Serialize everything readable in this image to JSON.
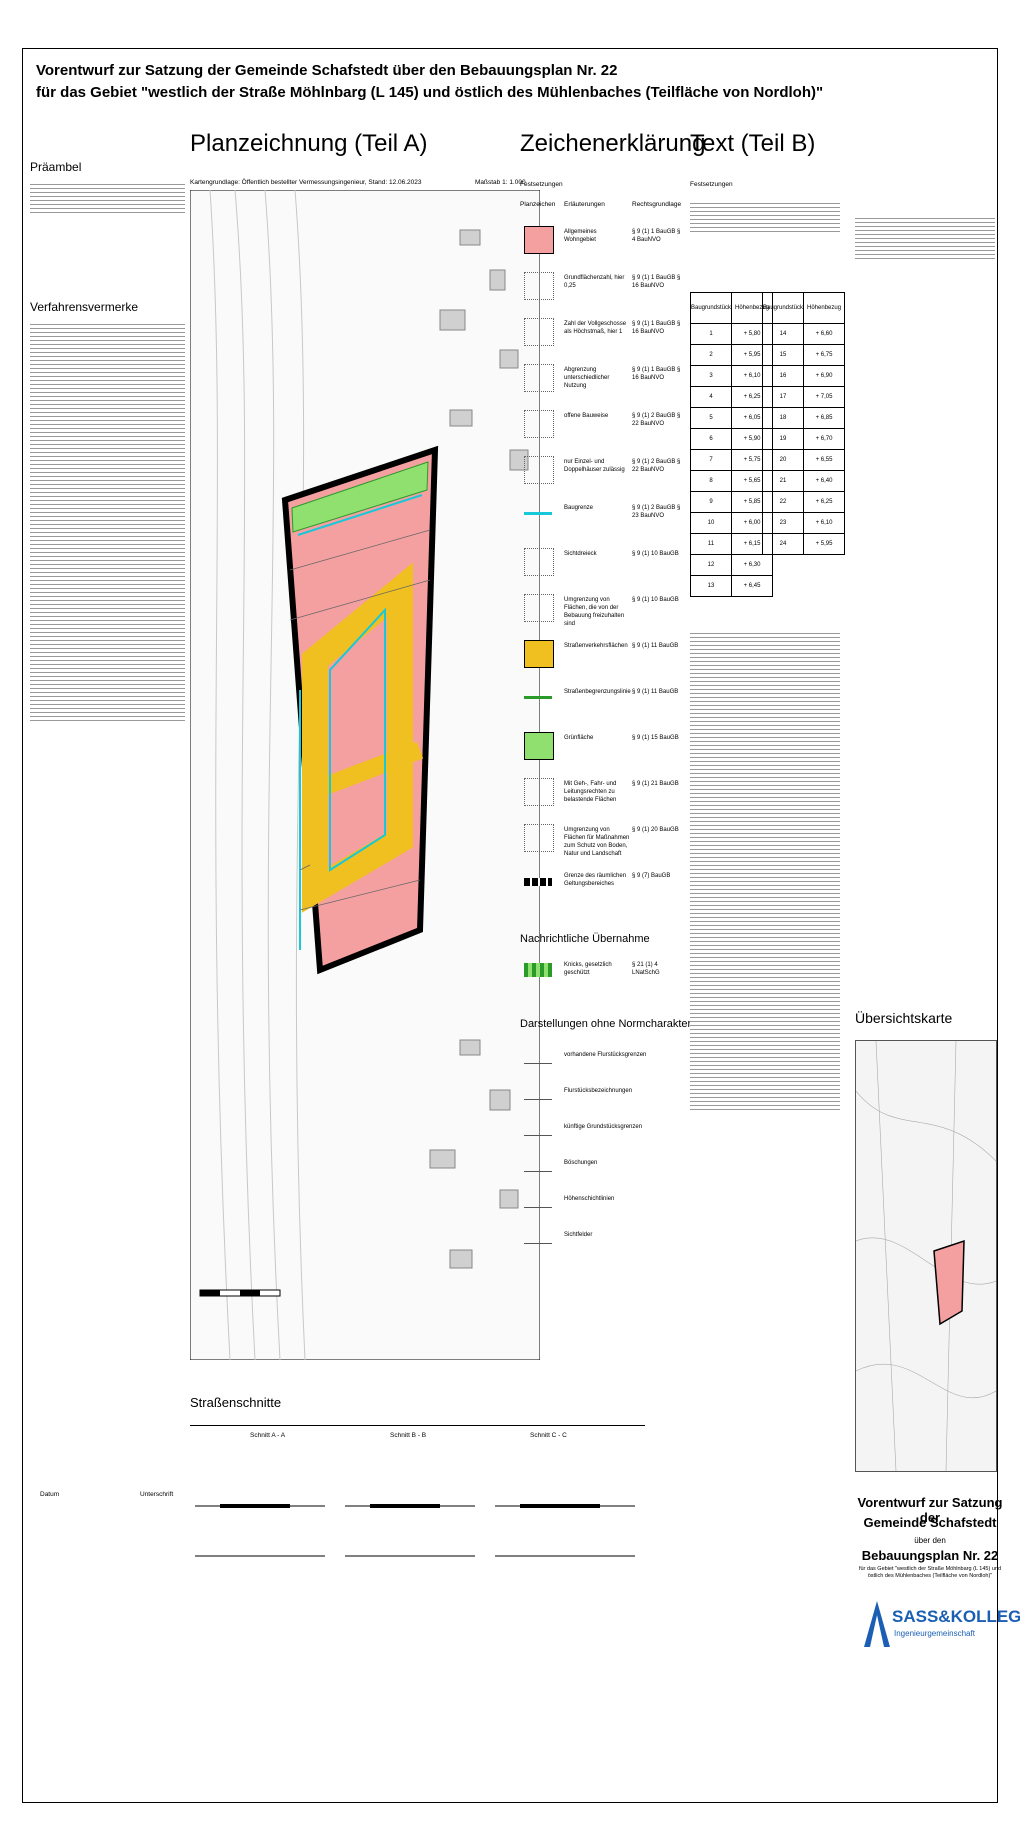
{
  "titles": {
    "line1": "Vorentwurf zur Satzung der Gemeinde Schafstedt über den Bebauungsplan Nr. 22",
    "line2": "für das Gebiet \"westlich der Straße Möhlnbarg (L 145) und östlich des Mühlenbaches (Teilfläche von Nordloh)\""
  },
  "sections": {
    "planzeichnung": "Planzeichnung (Teil A)",
    "zeichenerklaerung": "Zeichenerklärung",
    "text": "Text (Teil B)",
    "praeambel": "Präambel",
    "verfahrensvermerke": "Verfahrensvermerke",
    "festsetzungen": "Festsetzungen",
    "nachrichtliche": "Nachrichtliche Übernahme",
    "darstellungen": "Darstellungen ohne Normcharakter",
    "strassenschnitte": "Straßenschnitte",
    "uebersichtskarte": "Übersichtskarte"
  },
  "legend_header": {
    "c1": "Planzeichen",
    "c2": "Erläuterungen",
    "c3": "Rechtsgrundlage"
  },
  "legend_items": [
    {
      "label": "Allgemeines Wohngebiet",
      "law": "§ 9 (1) 1 BauGB § 4 BauNVO",
      "color": "#f4a0a0"
    },
    {
      "label": "Grundflächenzahl, hier 0,25",
      "law": "§ 9 (1) 1 BauGB § 16 BauNVO",
      "color": ""
    },
    {
      "label": "Zahl der Vollgeschosse als Höchstmaß, hier 1",
      "law": "§ 9 (1) 1 BauGB § 16 BauNVO",
      "color": ""
    },
    {
      "label": "Abgrenzung unterschiedlicher Nutzung",
      "law": "§ 9 (1) 1 BauGB § 16 BauNVO",
      "color": ""
    },
    {
      "label": "offene Bauweise",
      "law": "§ 9 (1) 2 BauGB § 22 BauNVO",
      "color": ""
    },
    {
      "label": "nur Einzel- und Doppelhäuser zulässig",
      "law": "§ 9 (1) 2 BauGB § 22 BauNVO",
      "color": ""
    },
    {
      "label": "Baugrenze",
      "law": "§ 9 (1) 2 BauGB § 23 BauNVO",
      "color": "#18c8d8"
    },
    {
      "label": "Sichtdreieck",
      "law": "§ 9 (1) 10 BauGB",
      "color": ""
    },
    {
      "label": "Umgrenzung von Flächen, die von der Bebauung freizuhalten sind",
      "law": "§ 9 (1) 10 BauGB",
      "color": ""
    },
    {
      "label": "Straßenverkehrsflächen",
      "law": "§ 9 (1) 11 BauGB",
      "color": "#f0c020"
    },
    {
      "label": "Straßenbegrenzungslinie",
      "law": "§ 9 (1) 11 BauGB",
      "color": "#2a9a2a"
    },
    {
      "label": "Grünfläche",
      "law": "§ 9 (1) 15 BauGB",
      "color": "#90e070"
    },
    {
      "label": "Mit Geh-, Fahr- und Leitungsrechten zu belastende Flächen",
      "law": "§ 9 (1) 21 BauGB",
      "color": ""
    },
    {
      "label": "Umgrenzung von Flächen für Maßnahmen zum Schutz von Boden, Natur und Landschaft",
      "law": "§ 9 (1) 20 BauGB",
      "color": ""
    },
    {
      "label": "Grenze des räumlichen Geltungsbereiches",
      "law": "§ 9 (7) BauGB",
      "color": "#000000"
    }
  ],
  "nachrichtliche_items": [
    {
      "label": "Knicks, gesetzlich geschützt",
      "law": "§ 21 (1) 4 LNatSchG"
    }
  ],
  "darstellungen_items": [
    "vorhandene Flurstücksgrenzen",
    "Flurstücksbezeichnungen",
    "künftige Grundstücksgrenzen",
    "Böschungen",
    "Höhenschichtlinien",
    "Sichtfelder"
  ],
  "plan": {
    "scale_note": "Maßstab 1: 1.000",
    "basis_note": "Kartengrundlage: Öffentlich bestellter Vermessungsingenieur, Stand: 12.06.2023"
  },
  "strassenschnitte": [
    "Schnitt A - A",
    "Schnitt B - B",
    "Schnitt C - C"
  ],
  "table_b": {
    "left_col_header": "Baugrundstück",
    "right_col_header": "Höhenbezug",
    "left_rows": [
      "1",
      "2",
      "3",
      "4",
      "5",
      "6",
      "7",
      "8",
      "9",
      "10",
      "11",
      "12",
      "13"
    ],
    "left_vals": [
      "+ 5,80",
      "+ 5,95",
      "+ 6,10",
      "+ 6,25",
      "+ 6,05",
      "+ 5,90",
      "+ 5,75",
      "+ 5,65",
      "+ 5,85",
      "+ 6,00",
      "+ 6,15",
      "+ 6,30",
      "+ 6,45"
    ],
    "right_rows": [
      "14",
      "15",
      "16",
      "17",
      "18",
      "19",
      "20",
      "21",
      "22",
      "23",
      "24"
    ],
    "right_vals": [
      "+ 6,60",
      "+ 6,75",
      "+ 6,90",
      "+ 7,05",
      "+ 6,85",
      "+ 6,70",
      "+ 6,55",
      "+ 6,40",
      "+ 6,25",
      "+ 6,10",
      "+ 5,95"
    ]
  },
  "stamp": {
    "line1": "Vorentwurf zur Satzung der",
    "line2": "Gemeinde Schafstedt",
    "line3": "über den",
    "line4": "Bebauungsplan Nr. 22",
    "line5": "für das Gebiet \"westlich der Straße Möhlnbarg (L 145) und östlich des Mühlenbaches (Teilfläche von Nordloh)\""
  },
  "logo": {
    "name": "SASS&KOLLEGEN",
    "sub": "Ingenieurgemeinschaft"
  },
  "sign": {
    "datum": "Datum",
    "unterschrift": "Unterschrift"
  },
  "colors": {
    "wohngebiet": "#f4a0a0",
    "strasse": "#f0c020",
    "gruen": "#90e070",
    "baugrenze": "#18c8d8",
    "geltungsbereich": "#000000"
  }
}
